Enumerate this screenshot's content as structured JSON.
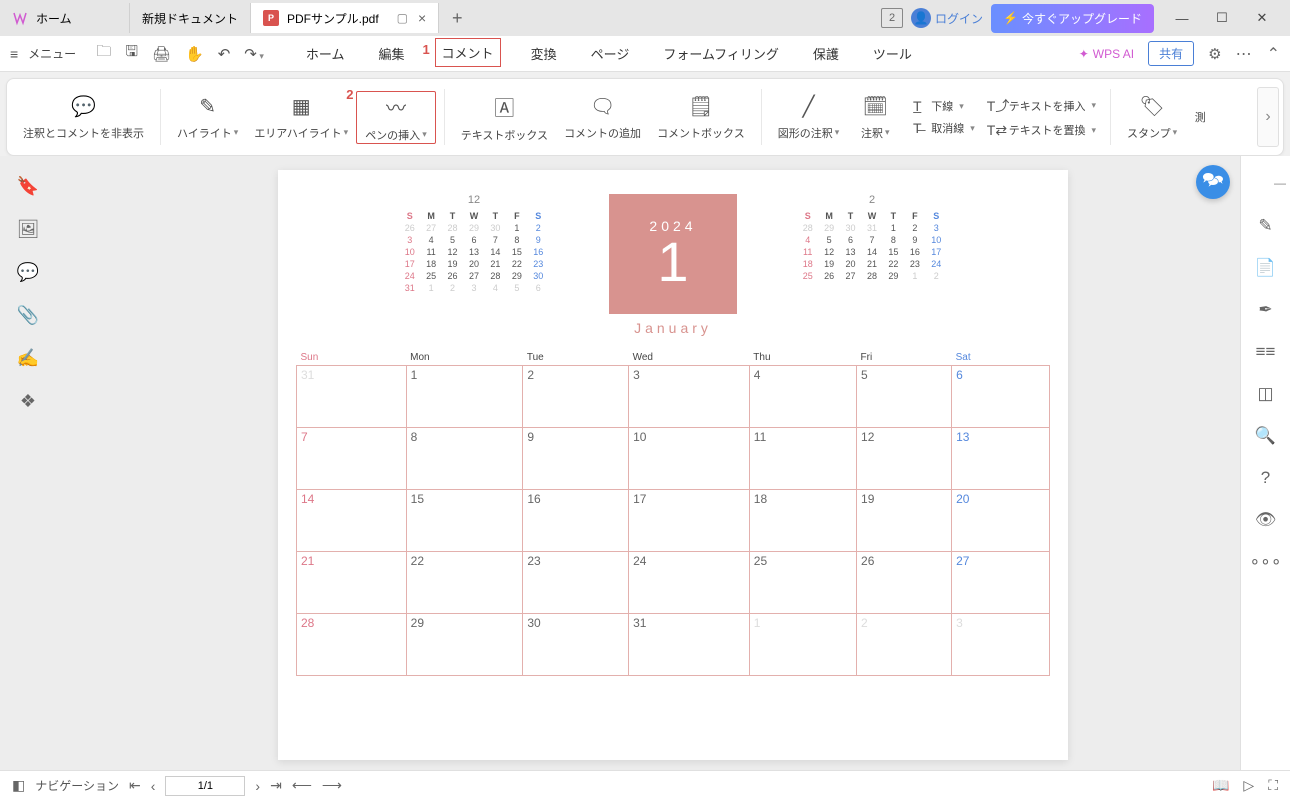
{
  "titlebar": {
    "home_tab": "ホーム",
    "new_doc_tab": "新規ドキュメント",
    "active_tab": "PDFサンプル.pdf",
    "box_badge": "2",
    "login": "ログイン",
    "upgrade": "今すぐアップグレード"
  },
  "menubar": {
    "menu": "メニュー",
    "tabs": {
      "home": "ホーム",
      "edit": "編集",
      "comment": "コメント",
      "convert": "変換",
      "page": "ページ",
      "form": "フォームフィリング",
      "protect": "保護",
      "tool": "ツール"
    },
    "callout1": "1",
    "wpsai": "WPS AI",
    "share": "共有"
  },
  "ribbon": {
    "hide_annot": "注釈とコメントを非表示",
    "highlight": "ハイライト",
    "area_hl": "エリアハイライト",
    "pen_insert": "ペンの挿入",
    "callout2": "2",
    "textbox": "テキストボックス",
    "add_comment": "コメントの追加",
    "comment_box": "コメントボックス",
    "shape_annot": "図形の注釈",
    "annot": "注釈",
    "underline": "下線",
    "strike": "取消線",
    "insert_text": "テキストを挿入",
    "replace_text": "テキストを置換",
    "stamp": "スタンプ",
    "measure": "測"
  },
  "statusbar": {
    "nav": "ナビゲーション",
    "page": "1/1"
  },
  "calendar": {
    "year": "2024",
    "month_num": "1",
    "month_name": "January",
    "prev_month": "12",
    "next_month": "2",
    "day_headers_short": [
      "S",
      "M",
      "T",
      "W",
      "T",
      "F",
      "S"
    ],
    "day_headers_long": [
      "Sun",
      "Mon",
      "Tue",
      "Wed",
      "Thu",
      "Fri",
      "Sat"
    ],
    "mini_prev": [
      [
        "26",
        "27",
        "28",
        "29",
        "30",
        "1",
        "2"
      ],
      [
        "3",
        "4",
        "5",
        "6",
        "7",
        "8",
        "9"
      ],
      [
        "10",
        "11",
        "12",
        "13",
        "14",
        "15",
        "16"
      ],
      [
        "17",
        "18",
        "19",
        "20",
        "21",
        "22",
        "23"
      ],
      [
        "24",
        "25",
        "26",
        "27",
        "28",
        "29",
        "30"
      ],
      [
        "31",
        "1",
        "2",
        "3",
        "4",
        "5",
        "6"
      ]
    ],
    "mini_next": [
      [
        "28",
        "29",
        "30",
        "31",
        "1",
        "2",
        "3"
      ],
      [
        "4",
        "5",
        "6",
        "7",
        "8",
        "9",
        "10"
      ],
      [
        "11",
        "12",
        "13",
        "14",
        "15",
        "16",
        "17"
      ],
      [
        "18",
        "19",
        "20",
        "21",
        "22",
        "23",
        "24"
      ],
      [
        "25",
        "26",
        "27",
        "28",
        "29",
        "1",
        "2"
      ]
    ],
    "main_grid": [
      [
        {
          "n": "31",
          "dim": true
        },
        {
          "n": "1"
        },
        {
          "n": "2"
        },
        {
          "n": "3"
        },
        {
          "n": "4"
        },
        {
          "n": "5"
        },
        {
          "n": "6"
        }
      ],
      [
        {
          "n": "7"
        },
        {
          "n": "8"
        },
        {
          "n": "9"
        },
        {
          "n": "10"
        },
        {
          "n": "11"
        },
        {
          "n": "12"
        },
        {
          "n": "13"
        }
      ],
      [
        {
          "n": "14"
        },
        {
          "n": "15"
        },
        {
          "n": "16"
        },
        {
          "n": "17"
        },
        {
          "n": "18"
        },
        {
          "n": "19"
        },
        {
          "n": "20"
        }
      ],
      [
        {
          "n": "21"
        },
        {
          "n": "22"
        },
        {
          "n": "23"
        },
        {
          "n": "24"
        },
        {
          "n": "25"
        },
        {
          "n": "26"
        },
        {
          "n": "27"
        }
      ],
      [
        {
          "n": "28"
        },
        {
          "n": "29"
        },
        {
          "n": "30"
        },
        {
          "n": "31"
        },
        {
          "n": "1",
          "dim": true
        },
        {
          "n": "2",
          "dim": true
        },
        {
          "n": "3",
          "dim": true
        }
      ]
    ]
  }
}
